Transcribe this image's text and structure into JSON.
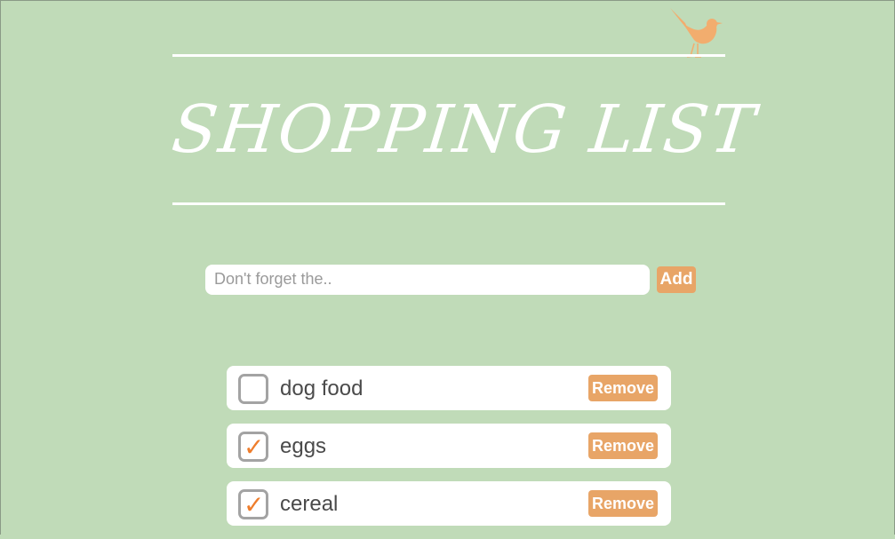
{
  "app": {
    "title": "SHOPPING LIST",
    "logo_icon": "bird-icon"
  },
  "add_form": {
    "placeholder": "Don't forget the..",
    "value": "",
    "add_label": "Add"
  },
  "items": [
    {
      "label": "dog food",
      "checked": false,
      "remove_label": "Remove"
    },
    {
      "label": "eggs",
      "checked": true,
      "remove_label": "Remove"
    },
    {
      "label": "cereal",
      "checked": true,
      "remove_label": "Remove"
    }
  ],
  "colors": {
    "background": "#c0dbb8",
    "accent": "#e8a567",
    "check": "#ee7d2c",
    "text": "#4a4a4a"
  }
}
